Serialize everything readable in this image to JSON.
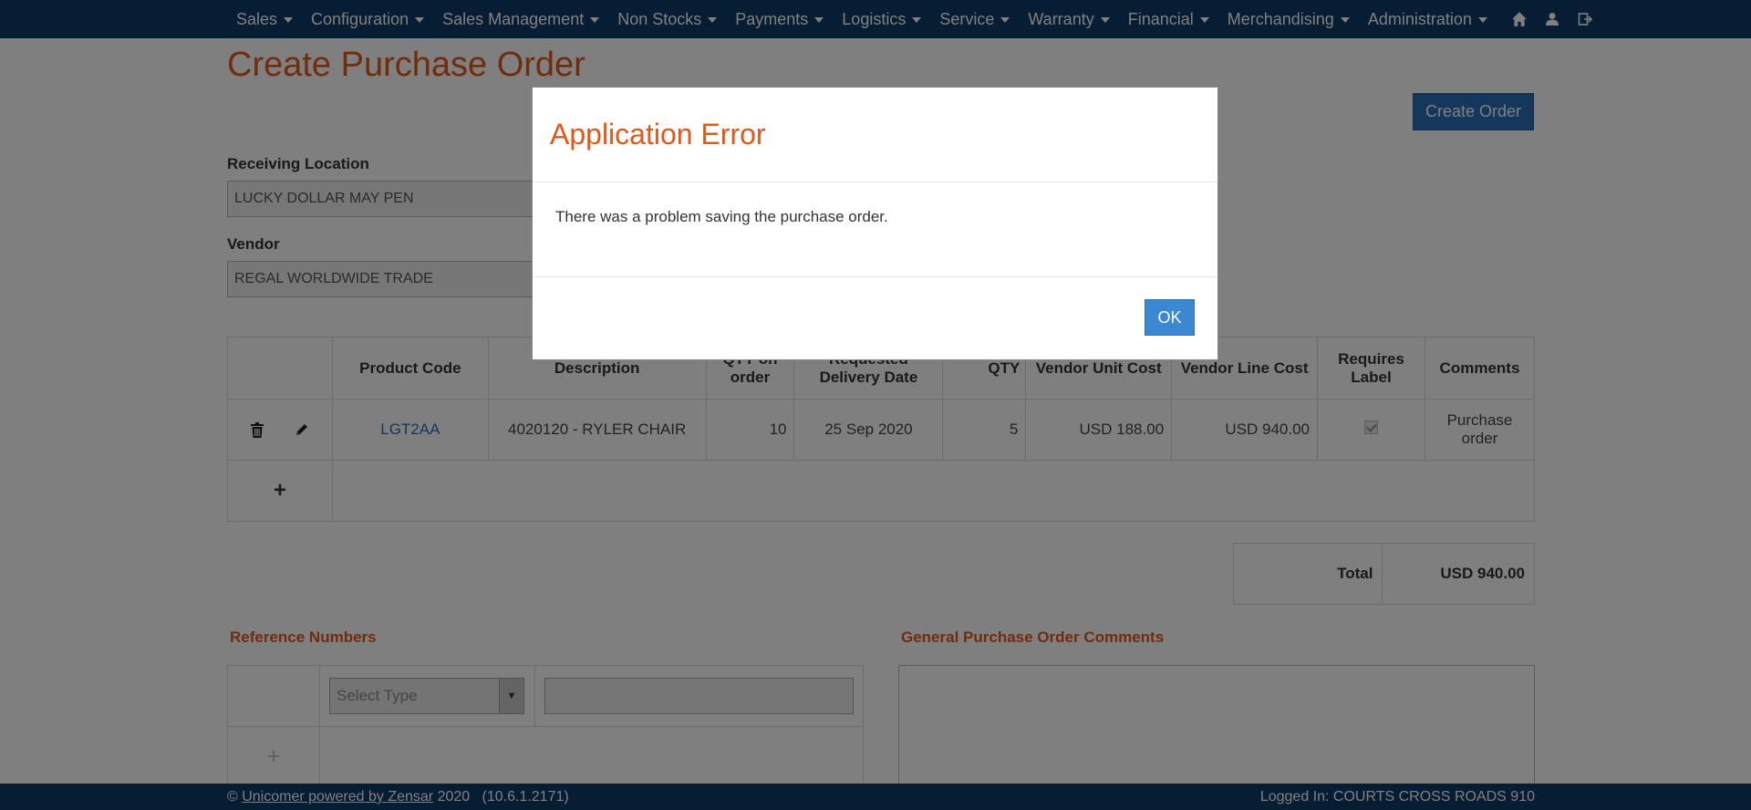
{
  "nav": {
    "items": [
      {
        "label": "Sales"
      },
      {
        "label": "Configuration"
      },
      {
        "label": "Sales Management"
      },
      {
        "label": "Non Stocks"
      },
      {
        "label": "Payments"
      },
      {
        "label": "Logistics"
      },
      {
        "label": "Service"
      },
      {
        "label": "Warranty"
      },
      {
        "label": "Financial"
      },
      {
        "label": "Merchandising"
      },
      {
        "label": "Administration"
      }
    ],
    "icons": [
      "home-icon",
      "user-icon",
      "logout-icon"
    ]
  },
  "page": {
    "title": "Create Purchase Order",
    "create_order_label": "Create Order"
  },
  "form": {
    "receiving_location_label": "Receiving Location",
    "receiving_location_value": "LUCKY DOLLAR MAY PEN",
    "vendor_label": "Vendor",
    "vendor_value": "REGAL WORLDWIDE TRADE"
  },
  "products": {
    "headers": {
      "product_code": "Product Code",
      "description": "Description",
      "qty_on_order": "QTY on order",
      "requested_delivery": "Requested Delivery Date",
      "qty": "QTY",
      "vendor_unit_cost": "Vendor Unit Cost",
      "vendor_line_cost": "Vendor Line Cost",
      "requires_label": "Requires Label",
      "comments": "Comments"
    },
    "rows": [
      {
        "product_code": "LGT2AA",
        "description": "4020120 - RYLER CHAIR",
        "qty_on_order": "10",
        "requested_delivery": "25 Sep 2020",
        "qty": "5",
        "vendor_unit_cost": "USD 188.00",
        "vendor_line_cost": "USD 940.00",
        "requires_label": true,
        "comments": "Purchase order"
      }
    ],
    "add_label": "+"
  },
  "totals": {
    "label": "Total",
    "value": "USD 940.00"
  },
  "reference": {
    "title": "Reference Numbers",
    "select_placeholder": "Select Type",
    "add_label": "+"
  },
  "comments": {
    "title": "General Purchase Order Comments"
  },
  "footer": {
    "copyright": "©",
    "link_text": "Unicomer powered by Zensar",
    "year_version": "2020   (10.6.1.2171)",
    "logged_in": "Logged In: COURTS CROSS ROADS 910"
  },
  "modal": {
    "title": "Application Error",
    "message": "There was a problem saving the purchase order.",
    "ok_label": "OK"
  },
  "colors": {
    "nav_bg": "#0f3a66",
    "accent_orange": "#e0581a",
    "primary_button": "#2a6fb6",
    "ok_button": "#3b87d1"
  }
}
